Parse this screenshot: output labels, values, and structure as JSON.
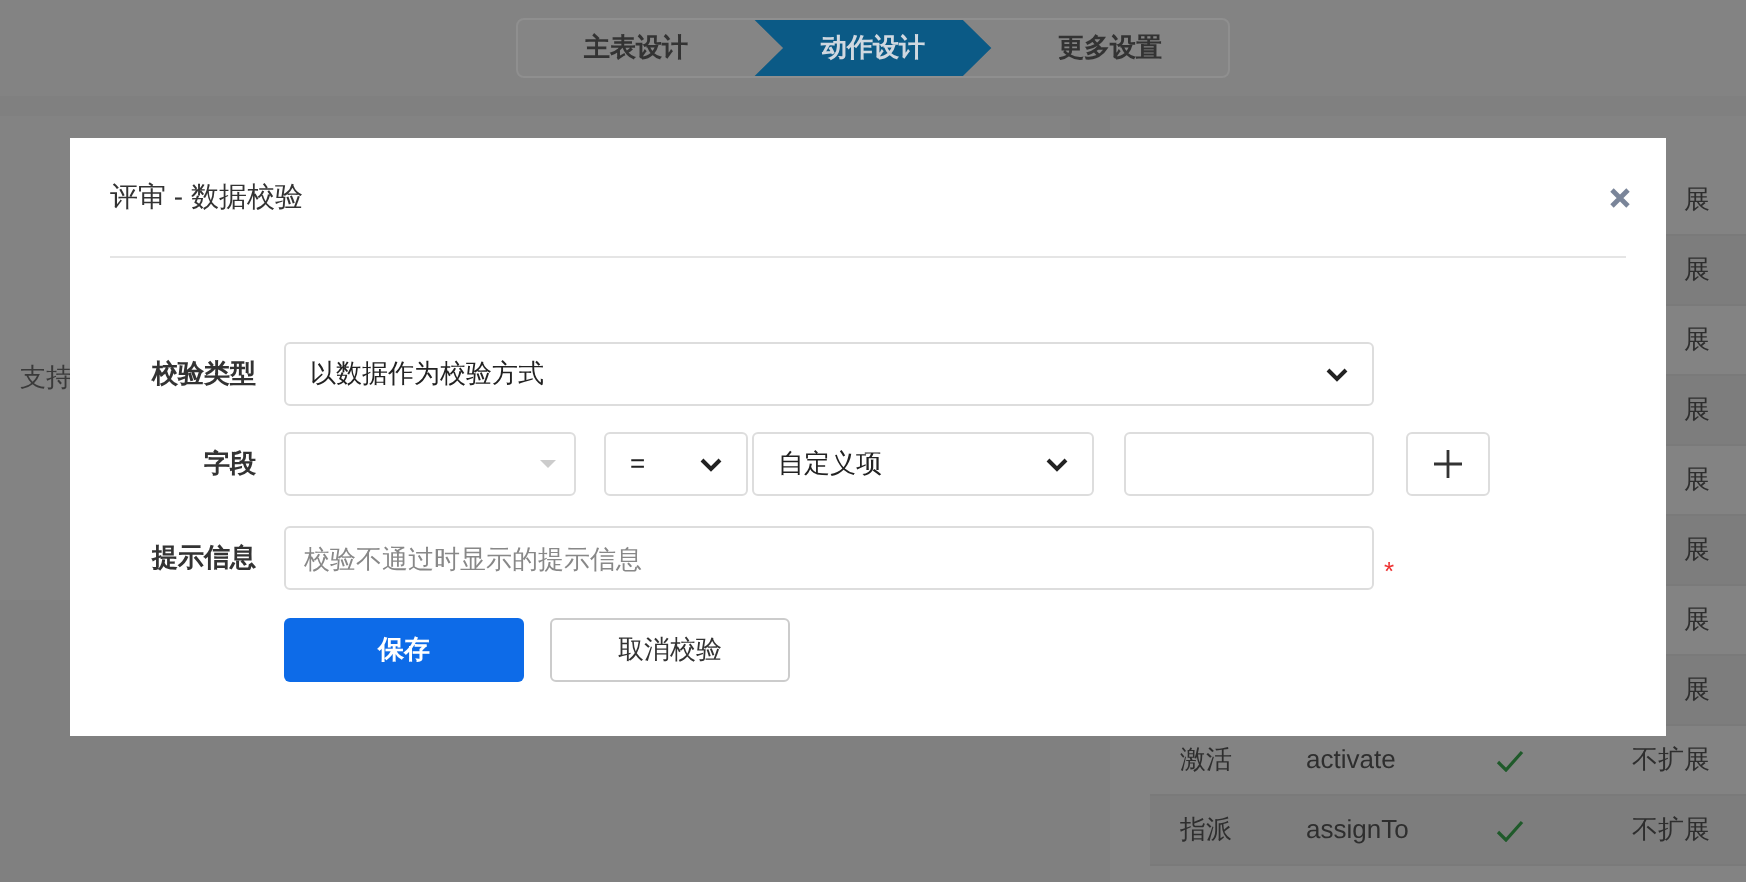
{
  "steps": [
    {
      "label": "主表设计",
      "selected": false
    },
    {
      "label": "动作设计",
      "selected": true
    },
    {
      "label": "更多设置",
      "selected": false
    }
  ],
  "left_panel": {
    "text": "支持"
  },
  "table": {
    "partly_covered_cells": [
      "展",
      "展",
      "展",
      "展",
      "展",
      "展",
      "展",
      "展"
    ],
    "rows": [
      {
        "name": "激活",
        "code": "activate",
        "checked": true,
        "ext": "不扩展"
      },
      {
        "name": "指派",
        "code": "assignTo",
        "checked": true,
        "ext": "不扩展"
      }
    ]
  },
  "dialog": {
    "title": "评审 - 数据校验",
    "check_type": {
      "label": "校验类型",
      "value": "以数据作为校验方式"
    },
    "field": {
      "label": "字段",
      "operator": "=",
      "value_type": "自定义项"
    },
    "hint": {
      "label": "提示信息",
      "placeholder": "校验不通过时显示的提示信息",
      "required_mark": "*"
    },
    "buttons": [
      {
        "label": "保存",
        "kind": "primary"
      },
      {
        "label": "取消校验",
        "kind": "default"
      }
    ]
  }
}
